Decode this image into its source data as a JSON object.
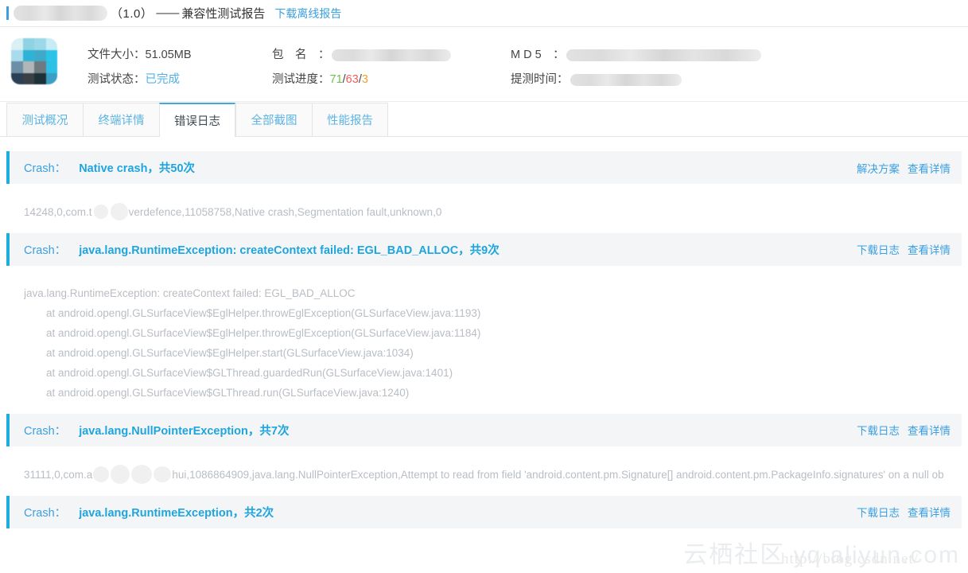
{
  "header": {
    "app_name_redacted": true,
    "version": "（1.0）",
    "dash": "——",
    "title": "兼容性测试报告",
    "download_link": "下载离线报告"
  },
  "info": {
    "app_icon": "app-icon-blurred",
    "rows": [
      {
        "label": "文件大小：",
        "value": "51.05MB",
        "redacted": false
      },
      {
        "label": "测试状态：",
        "value": "已完成",
        "redacted": false
      },
      {
        "label": "包　名　：",
        "value": "",
        "redacted": true
      },
      {
        "label": "测试进度：",
        "value": "",
        "redacted": false,
        "progress": {
          "pass": "71",
          "fail": "63",
          "error": "3",
          "sep": "/"
        }
      },
      {
        "label": "M D 5　：",
        "value": "",
        "redacted": true
      },
      {
        "label": "提测时间：",
        "value": "",
        "redacted": true
      }
    ]
  },
  "tabs": [
    {
      "label": "测试概况",
      "active": false
    },
    {
      "label": "终端详情",
      "active": false
    },
    {
      "label": "错误日志",
      "active": true
    },
    {
      "label": "全部截图",
      "active": false
    },
    {
      "label": "性能报告",
      "active": false
    }
  ],
  "crashes": [
    {
      "label": "Crash：",
      "title": "Native crash，共50次",
      "actions": [
        "解决方案",
        "查看详情"
      ],
      "log": [
        {
          "indent": 0,
          "pre": "14248,0,com.t",
          "blob": true,
          "post": "verdefence,11058758,Native crash,Segmentation fault,unknown,0"
        }
      ]
    },
    {
      "label": "Crash：",
      "title": "java.lang.RuntimeException: createContext failed: EGL_BAD_ALLOC，共9次",
      "actions": [
        "下载日志",
        "查看详情"
      ],
      "log": [
        {
          "indent": 0,
          "text": "java.lang.RuntimeException: createContext failed: EGL_BAD_ALLOC"
        },
        {
          "indent": 1,
          "text": "at android.opengl.GLSurfaceView$EglHelper.throwEglException(GLSurfaceView.java:1193)"
        },
        {
          "indent": 1,
          "text": "at android.opengl.GLSurfaceView$EglHelper.throwEglException(GLSurfaceView.java:1184)"
        },
        {
          "indent": 1,
          "text": "at android.opengl.GLSurfaceView$EglHelper.start(GLSurfaceView.java:1034)"
        },
        {
          "indent": 1,
          "text": "at android.opengl.GLSurfaceView$GLThread.guardedRun(GLSurfaceView.java:1401)"
        },
        {
          "indent": 1,
          "text": "at android.opengl.GLSurfaceView$GLThread.run(GLSurfaceView.java:1240)"
        }
      ]
    },
    {
      "label": "Crash：",
      "title": "java.lang.NullPointerException，共7次",
      "actions": [
        "下载日志",
        "查看详情"
      ],
      "log": [
        {
          "indent": 0,
          "pre": "31111,0,com.a",
          "blob": true,
          "post": "hui,1086864909,java.lang.NullPointerException,Attempt to read from field 'android.content.pm.Signature[] android.content.pm.PackageInfo.signatures' on a null ob"
        }
      ]
    },
    {
      "label": "Crash：",
      "title": "java.lang.RuntimeException，共2次",
      "actions": [
        "下载日志",
        "查看详情"
      ],
      "log": []
    }
  ],
  "watermarks": {
    "aliyun": "云栖社区 yq.aliyun.com",
    "csdn": "http://blog.csdn.net/"
  },
  "colors": {
    "accent": "#1eaedb",
    "link": "#3aa0e0",
    "pass": "#6cc24a",
    "fail": "#f25f5c",
    "error": "#f0a030"
  }
}
